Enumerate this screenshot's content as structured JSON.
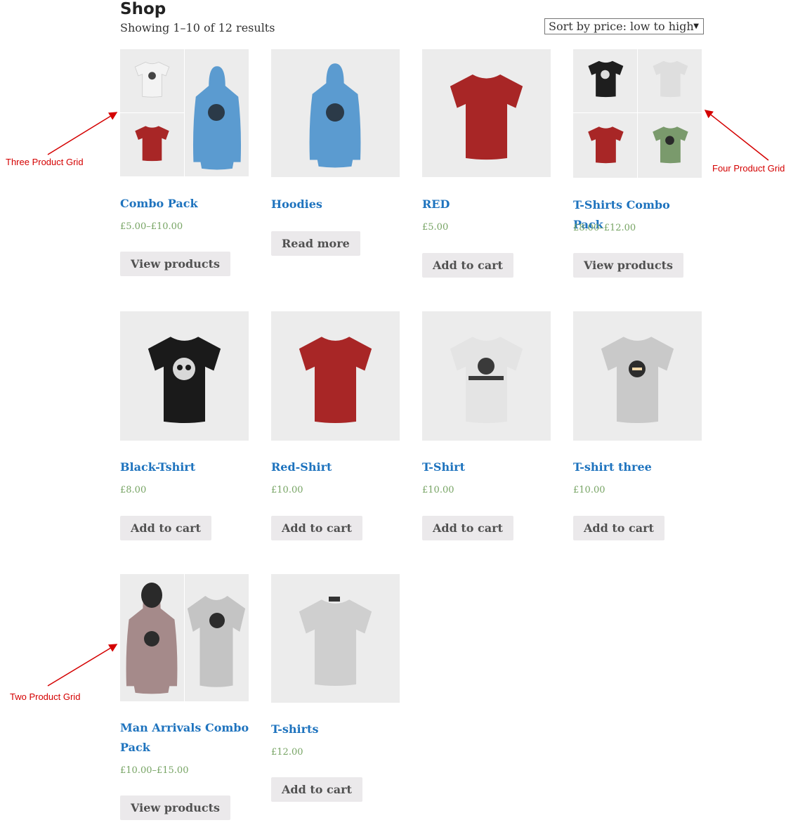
{
  "shop": {
    "title": "Shop",
    "result_count": "Showing 1–10 of 12 results",
    "orderby_selected": "Sort by price: low to high"
  },
  "products": [
    {
      "title": "Combo Pack",
      "price": "£5.00–£10.00",
      "button": "View products"
    },
    {
      "title": "Hoodies",
      "price": "",
      "button": "Read more"
    },
    {
      "title": "RED",
      "price": "£5.00",
      "button": "Add to cart"
    },
    {
      "title": "T-Shirts Combo Pack",
      "price": "£8.00–£12.00",
      "button": "View products"
    },
    {
      "title": "Black-Tshirt",
      "price": "£8.00",
      "button": "Add to cart"
    },
    {
      "title": "Red-Shirt",
      "price": "£10.00",
      "button": "Add to cart"
    },
    {
      "title": "T-Shirt",
      "price": "£10.00",
      "button": "Add to cart"
    },
    {
      "title": "T-shirt three",
      "price": "£10.00",
      "button": "Add to cart"
    },
    {
      "title": "Man Arrivals Combo Pack",
      "price": "£10.00–£15.00",
      "button": "View products"
    },
    {
      "title": "T-shirts",
      "price": "£12.00",
      "button": "Add to cart"
    }
  ],
  "annotations": {
    "three_grid": "Three Product Grid",
    "four_grid": "Four Product Grid",
    "two_grid": "Two Product Grid"
  },
  "colors": {
    "link": "#1e73be",
    "price": "#77a464",
    "button_bg": "#ebe9eb",
    "annotation": "#d40000",
    "tile_bg": "#ececec"
  }
}
